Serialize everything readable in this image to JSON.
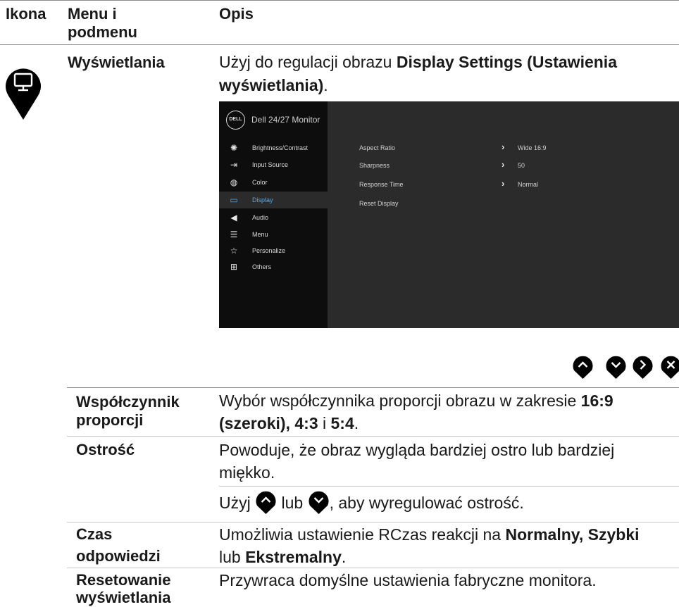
{
  "header": {
    "col1": "Ikona",
    "col2a": "Menu i",
    "col2b": "podmenu",
    "col3": "Opis"
  },
  "display_row": {
    "menu": "Wyświetlania",
    "desc_pre": "Użyj do regulacji obrazu ",
    "desc_bold1": "Display Settings (Ustawienia",
    "desc_bold2": "wyświetlania)",
    "desc_post": "."
  },
  "osd": {
    "logo": "DELL",
    "title": "Dell 24/27 Monitor",
    "menu": [
      {
        "label": "Brightness/Contrast",
        "icon": "sun-icon"
      },
      {
        "label": "Input Source",
        "icon": "input-icon"
      },
      {
        "label": "Color",
        "icon": "palette-icon"
      },
      {
        "label": "Display",
        "icon": "monitor-icon"
      },
      {
        "label": "Audio",
        "icon": "speaker-icon"
      },
      {
        "label": "Menu",
        "icon": "menu-icon"
      },
      {
        "label": "Personalize",
        "icon": "star-icon"
      },
      {
        "label": "Others",
        "icon": "others-icon"
      }
    ],
    "active_item": "Display",
    "settings": [
      {
        "label": "Aspect Ratio",
        "value": "Wide 16:9"
      },
      {
        "label": "Sharpness",
        "value": "50"
      },
      {
        "label": "Response Time",
        "value": "Normal"
      },
      {
        "label": "Reset Display",
        "value": ""
      }
    ]
  },
  "nav_buttons": [
    "chevron-up-icon",
    "chevron-down-icon",
    "chevron-right-icon",
    "close-icon"
  ],
  "rows": {
    "aspect": {
      "name1": "Współczynnik",
      "name2": "proporcji",
      "d1": "Wybór współczynnika proporcji obrazu w zakresie ",
      "d1b": "16:9",
      "d2b": "(szeroki), 4:3",
      "d2m": " i ",
      "d2b2": "5:4",
      "d2e": "."
    },
    "sharpness": {
      "name": "Ostrość",
      "d1": "Powoduje, że obraz wygląda bardziej ostro lub bardziej",
      "d2": "miękko.",
      "d3a": "Użyj ",
      "d3b": " lub ",
      "d3c": ", aby wyregulować ostrość."
    },
    "response": {
      "name1": "Czas",
      "name2": "odpowiedzi",
      "d1": "Umożliwia ustawienie RCzas reakcji na ",
      "d1b": "Normalny, Szybki",
      "d2": "lub ",
      "d2b": "Ekstremalny",
      "d2e": "."
    },
    "reset": {
      "name1": "Resetowanie",
      "name2": "wyświetlania",
      "d1": "Przywraca domyślne ustawienia fabryczne monitora."
    }
  }
}
